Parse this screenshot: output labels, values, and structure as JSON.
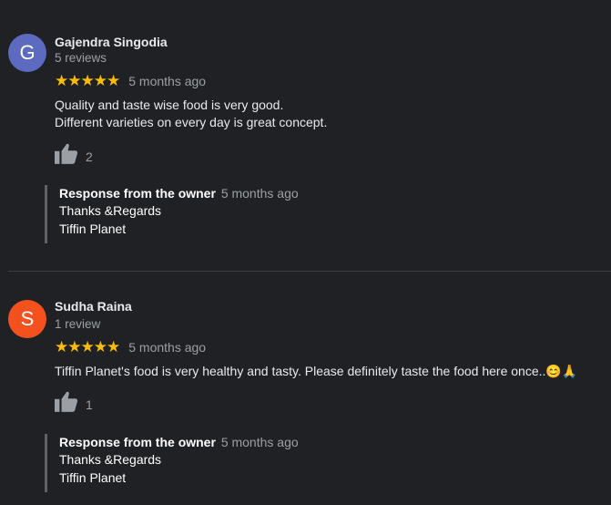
{
  "reviews": [
    {
      "avatar_letter": "G",
      "avatar_color": "#5c6bc0",
      "name": "Gajendra Singodia",
      "review_count": "5 reviews",
      "stars": 5,
      "time": "5 months ago",
      "text": "Quality and taste wise food is very good.\nDifferent varieties on every day is great concept.",
      "likes": "2",
      "response": {
        "title": "Response from the owner",
        "time": "5 months ago",
        "text": "Thanks &Regards\nTiffin Planet"
      }
    },
    {
      "avatar_letter": "S",
      "avatar_color": "#f4511e",
      "name": "Sudha Raina",
      "review_count": "1 review",
      "stars": 5,
      "time": "5 months ago",
      "text": "Tiffin Planet's food is very healthy and tasty. Please definitely taste the food here once..😊🙏",
      "likes": "1",
      "response": {
        "title": "Response from the owner",
        "time": "5 months ago",
        "text": "Thanks &Regards\nTiffin Planet"
      }
    }
  ],
  "colors": {
    "background": "#202124",
    "star": "#fbbc04",
    "muted": "#9aa0a6"
  },
  "icons": {
    "like": "thumbs-up-icon",
    "star": "star-icon"
  }
}
